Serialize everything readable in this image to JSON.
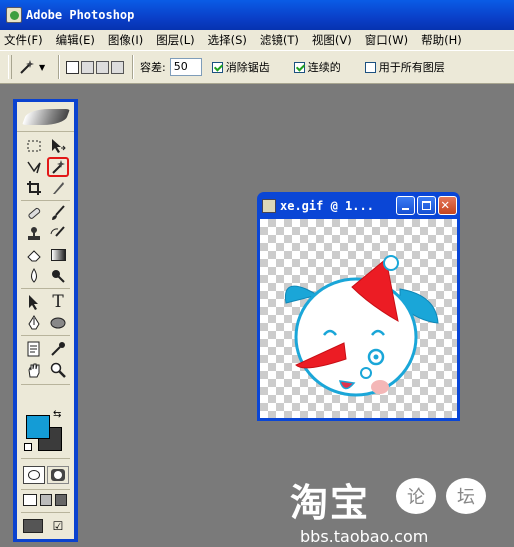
{
  "app": {
    "title": "Adobe Photoshop"
  },
  "menu": [
    "文件(F)",
    "编辑(E)",
    "图像(I)",
    "图层(L)",
    "选择(S)",
    "滤镜(T)",
    "视图(V)",
    "窗口(W)",
    "帮助(H)"
  ],
  "options": {
    "tolerance_label": "容差:",
    "tolerance_value": "50",
    "anti_alias_label": "消除锯齿",
    "anti_alias_checked": true,
    "contiguous_label": "连续的",
    "contiguous_checked": true,
    "all_layers_label": "用于所有图层",
    "all_layers_checked": false
  },
  "toolbox": {
    "foreground_color": "#149cd6",
    "background_color": "#3b3b3b",
    "type_tool_label": "T",
    "selected_tool": "magic-wand-icon"
  },
  "document": {
    "title": "xe.gif @ 1..."
  },
  "watermark": {
    "logo_text": "淘宝",
    "bubble1": "论",
    "bubble2": "坛",
    "url": "bbs.taobao.com"
  }
}
